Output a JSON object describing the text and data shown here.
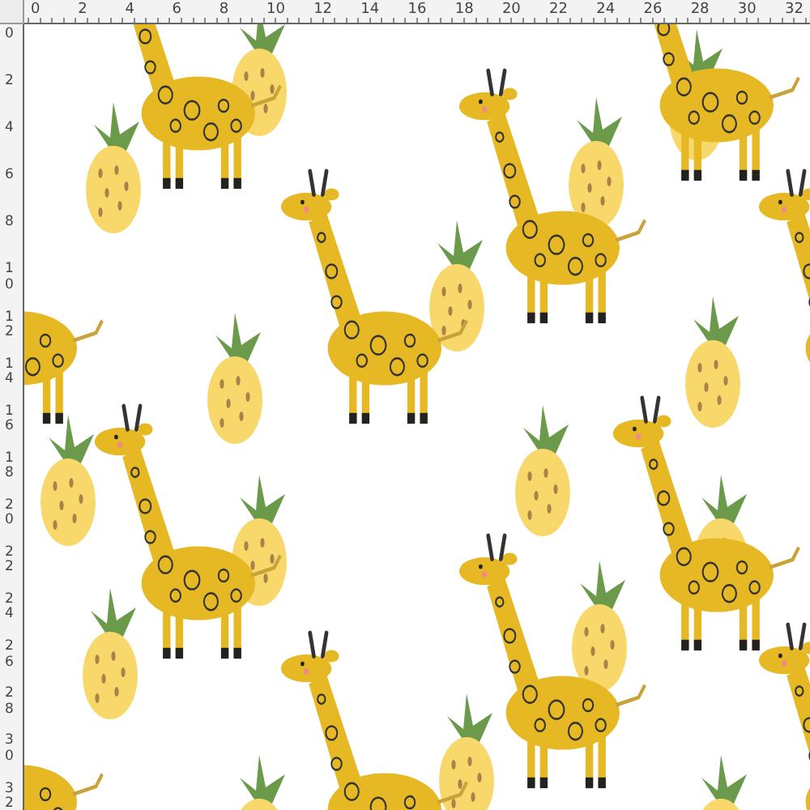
{
  "horizontal_ruler": {
    "labels": [
      "0",
      "2",
      "4",
      "6",
      "8",
      "10",
      "12",
      "14",
      "16",
      "18",
      "20",
      "22",
      "24",
      "26",
      "28",
      "30",
      "32"
    ]
  },
  "vertical_ruler": {
    "labels": [
      "0",
      "2",
      "4",
      "6",
      "8",
      "10",
      "12",
      "14",
      "16",
      "18",
      "20",
      "22",
      "24",
      "26",
      "28",
      "30",
      "32"
    ]
  }
}
